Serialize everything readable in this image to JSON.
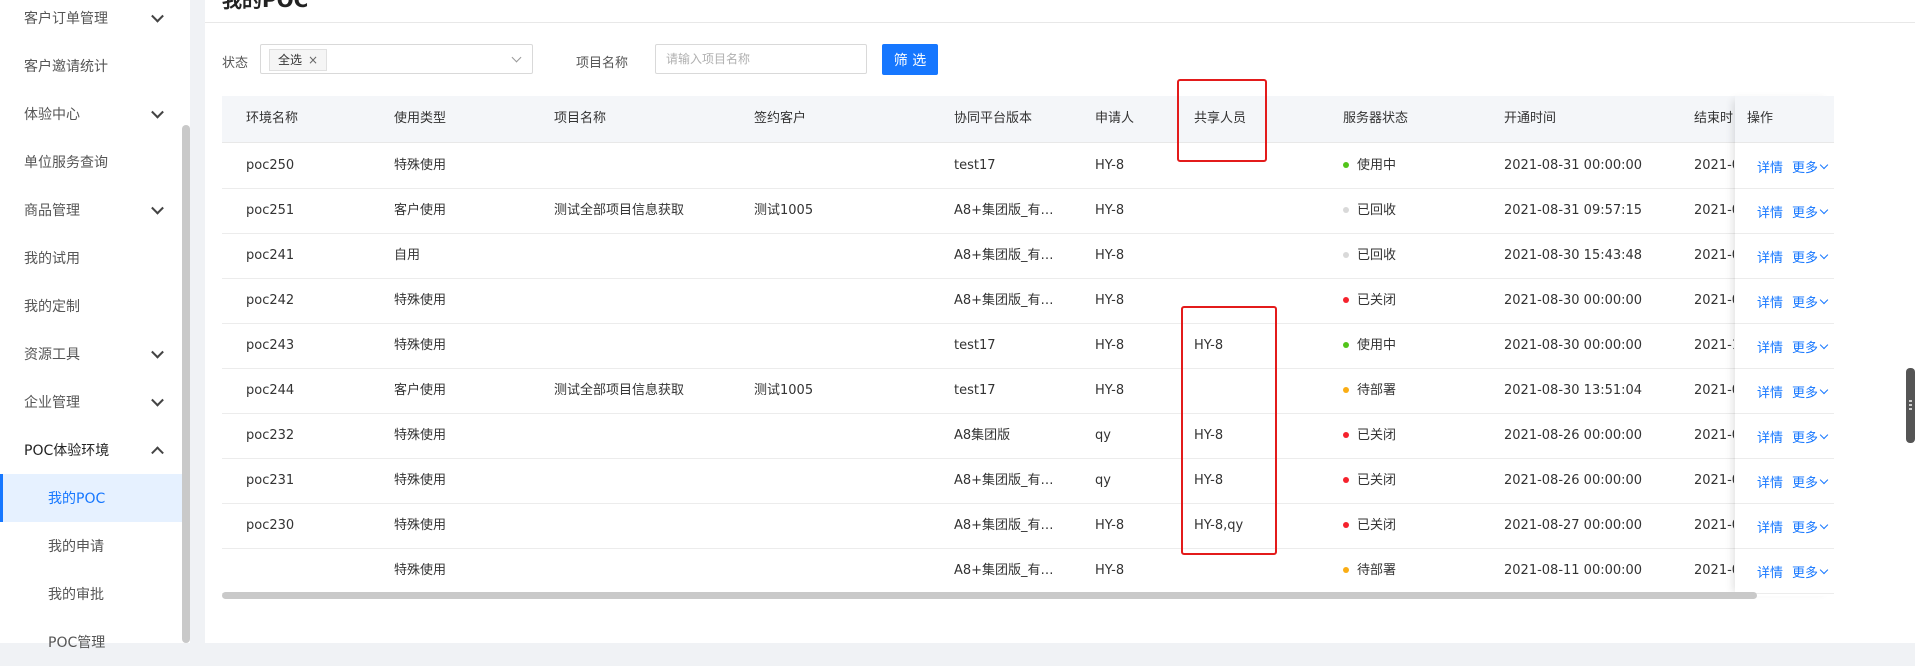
{
  "sidebar": {
    "items": [
      {
        "label": "客户订单管理",
        "expandable": true
      },
      {
        "label": "客户邀请统计",
        "expandable": false
      },
      {
        "label": "体验中心",
        "expandable": true
      },
      {
        "label": "单位服务查询",
        "expandable": false
      },
      {
        "label": "商品管理",
        "expandable": true
      },
      {
        "label": "我的试用",
        "expandable": false
      },
      {
        "label": "我的定制",
        "expandable": false
      },
      {
        "label": "资源工具",
        "expandable": true
      },
      {
        "label": "企业管理",
        "expandable": true
      },
      {
        "label": "POC体验环境",
        "expandable": true,
        "expanded": true
      },
      {
        "label": "我的POC",
        "sub": true,
        "active": true
      },
      {
        "label": "我的申请",
        "sub": true
      },
      {
        "label": "我的审批",
        "sub": true
      },
      {
        "label": "POC管理",
        "sub": true
      }
    ]
  },
  "page": {
    "title": "我的POC"
  },
  "filters": {
    "status_label": "状态",
    "status_tag": "全选",
    "project_label": "项目名称",
    "project_placeholder": "请输入项目名称",
    "filter_button": "筛 选"
  },
  "table": {
    "headers": [
      "环境名称",
      "使用类型",
      "项目名称",
      "签约客户",
      "协同平台版本",
      "申请人",
      "共享人员",
      "服务器状态",
      "开通时间",
      "结束时"
    ],
    "op_header": "操作",
    "op_detail": "详情",
    "op_more": "更多",
    "rows": [
      {
        "env": "poc250",
        "type": "特殊使用",
        "project": "",
        "customer": "",
        "version": "test17",
        "applicant": "HY-8",
        "shared": "",
        "status": "使用中",
        "status_color": "#52c41a",
        "open_time": "2021-08-31 00:00:00",
        "end": "2021-0"
      },
      {
        "env": "poc251",
        "type": "客户使用",
        "project": "测试全部项目信息获取",
        "customer": "测试1005",
        "version": "A8+集团版_有…",
        "applicant": "HY-8",
        "shared": "",
        "status": "已回收",
        "status_color": "#d9d9d9",
        "open_time": "2021-08-31 09:57:15",
        "end": "2021-0"
      },
      {
        "env": "poc241",
        "type": "自用",
        "project": "",
        "customer": "",
        "version": "A8+集团版_有…",
        "applicant": "HY-8",
        "shared": "",
        "status": "已回收",
        "status_color": "#d9d9d9",
        "open_time": "2021-08-30 15:43:48",
        "end": "2021-0"
      },
      {
        "env": "poc242",
        "type": "特殊使用",
        "project": "",
        "customer": "",
        "version": "A8+集团版_有…",
        "applicant": "HY-8",
        "shared": "",
        "status": "已关闭",
        "status_color": "#f5222d",
        "open_time": "2021-08-30 00:00:00",
        "end": "2021-0"
      },
      {
        "env": "poc243",
        "type": "特殊使用",
        "project": "",
        "customer": "",
        "version": "test17",
        "applicant": "HY-8",
        "shared": "HY-8",
        "status": "使用中",
        "status_color": "#52c41a",
        "open_time": "2021-08-30 00:00:00",
        "end": "2021-1"
      },
      {
        "env": "poc244",
        "type": "客户使用",
        "project": "测试全部项目信息获取",
        "customer": "测试1005",
        "version": "test17",
        "applicant": "HY-8",
        "shared": "",
        "status": "待部署",
        "status_color": "#faad14",
        "open_time": "2021-08-30 13:51:04",
        "end": "2021-0"
      },
      {
        "env": "poc232",
        "type": "特殊使用",
        "project": "",
        "customer": "",
        "version": "A8集团版",
        "applicant": "qy",
        "shared": "HY-8",
        "status": "已关闭",
        "status_color": "#f5222d",
        "open_time": "2021-08-26 00:00:00",
        "end": "2021-0"
      },
      {
        "env": "poc231",
        "type": "特殊使用",
        "project": "",
        "customer": "",
        "version": "A8+集团版_有…",
        "applicant": "qy",
        "shared": "HY-8",
        "status": "已关闭",
        "status_color": "#f5222d",
        "open_time": "2021-08-26 00:00:00",
        "end": "2021-0"
      },
      {
        "env": "poc230",
        "type": "特殊使用",
        "project": "",
        "customer": "",
        "version": "A8+集团版_有…",
        "applicant": "HY-8",
        "shared": "HY-8,qy",
        "status": "已关闭",
        "status_color": "#f5222d",
        "open_time": "2021-08-27 00:00:00",
        "end": "2021-0"
      },
      {
        "env": "",
        "type": "特殊使用",
        "project": "",
        "customer": "",
        "version": "A8+集团版_有…",
        "applicant": "HY-8",
        "shared": "",
        "status": "待部署",
        "status_color": "#faad14",
        "open_time": "2021-08-11 00:00:00",
        "end": "2021-0"
      }
    ]
  },
  "highlight_color": "#e31b1b"
}
